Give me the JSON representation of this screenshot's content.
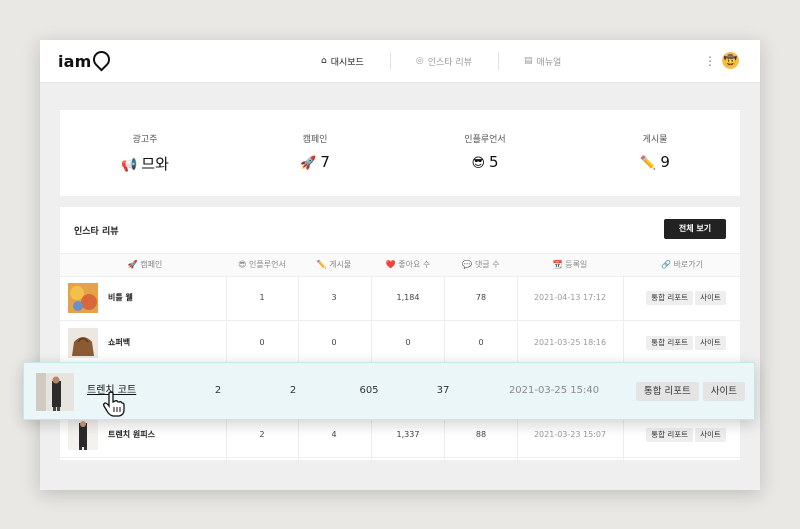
{
  "app": {
    "logo": "iam",
    "logo_icon": "location-pin-icon"
  },
  "nav": {
    "tabs": [
      {
        "label": "대시보드",
        "icon": "⌂",
        "active": true
      },
      {
        "label": "인스타 리뷰",
        "icon": "◎",
        "active": false
      },
      {
        "label": "매뉴얼",
        "icon": "▤",
        "active": false
      }
    ],
    "kebab": "⋮",
    "avatar": "🤠"
  },
  "stats": [
    {
      "label": "광고주",
      "icon": "📢",
      "value": "므와"
    },
    {
      "label": "캠페인",
      "icon": "🚀",
      "value": "7"
    },
    {
      "label": "인플루언서",
      "icon": "😎",
      "value": "5"
    },
    {
      "label": "게시물",
      "icon": "✏️",
      "value": "9"
    }
  ],
  "reviews": {
    "title": "인스타 리뷰",
    "view_all": "전체 보기",
    "headers": [
      {
        "icon": "🚀",
        "label": "캠페인"
      },
      {
        "icon": "😎",
        "label": "인플루언서"
      },
      {
        "icon": "✏️",
        "label": "게시물"
      },
      {
        "icon": "❤️",
        "label": "좋아요 수"
      },
      {
        "icon": "💬",
        "label": "댓글 수"
      },
      {
        "icon": "📆",
        "label": "등록일"
      },
      {
        "icon": "🔗",
        "label": "바로가기"
      }
    ],
    "rows": [
      {
        "name": "비틀 웰",
        "influencers": "1",
        "posts": "3",
        "likes": "1,184",
        "comments": "78",
        "date": "2021-04-13 17:12",
        "report": "통합 리포트",
        "site": "사이트"
      },
      {
        "name": "쇼퍼백",
        "influencers": "0",
        "posts": "0",
        "likes": "0",
        "comments": "0",
        "date": "2021-03-25 18:16",
        "report": "통합 리포트",
        "site": "사이트"
      },
      {
        "name": "트렌치 원피스",
        "influencers": "2",
        "posts": "4",
        "likes": "1,337",
        "comments": "88",
        "date": "2021-03-23 15:07",
        "report": "통합 리포트",
        "site": "사이트"
      }
    ],
    "highlighted": {
      "name": "트렌치 코트",
      "influencers": "2",
      "posts": "2",
      "likes": "605",
      "comments": "37",
      "date": "2021-03-25 15:40",
      "report": "통합 리포트",
      "site": "사이트"
    }
  },
  "colors": {
    "accent_dark": "#222222",
    "highlight_bg": "#eaf6f8"
  }
}
